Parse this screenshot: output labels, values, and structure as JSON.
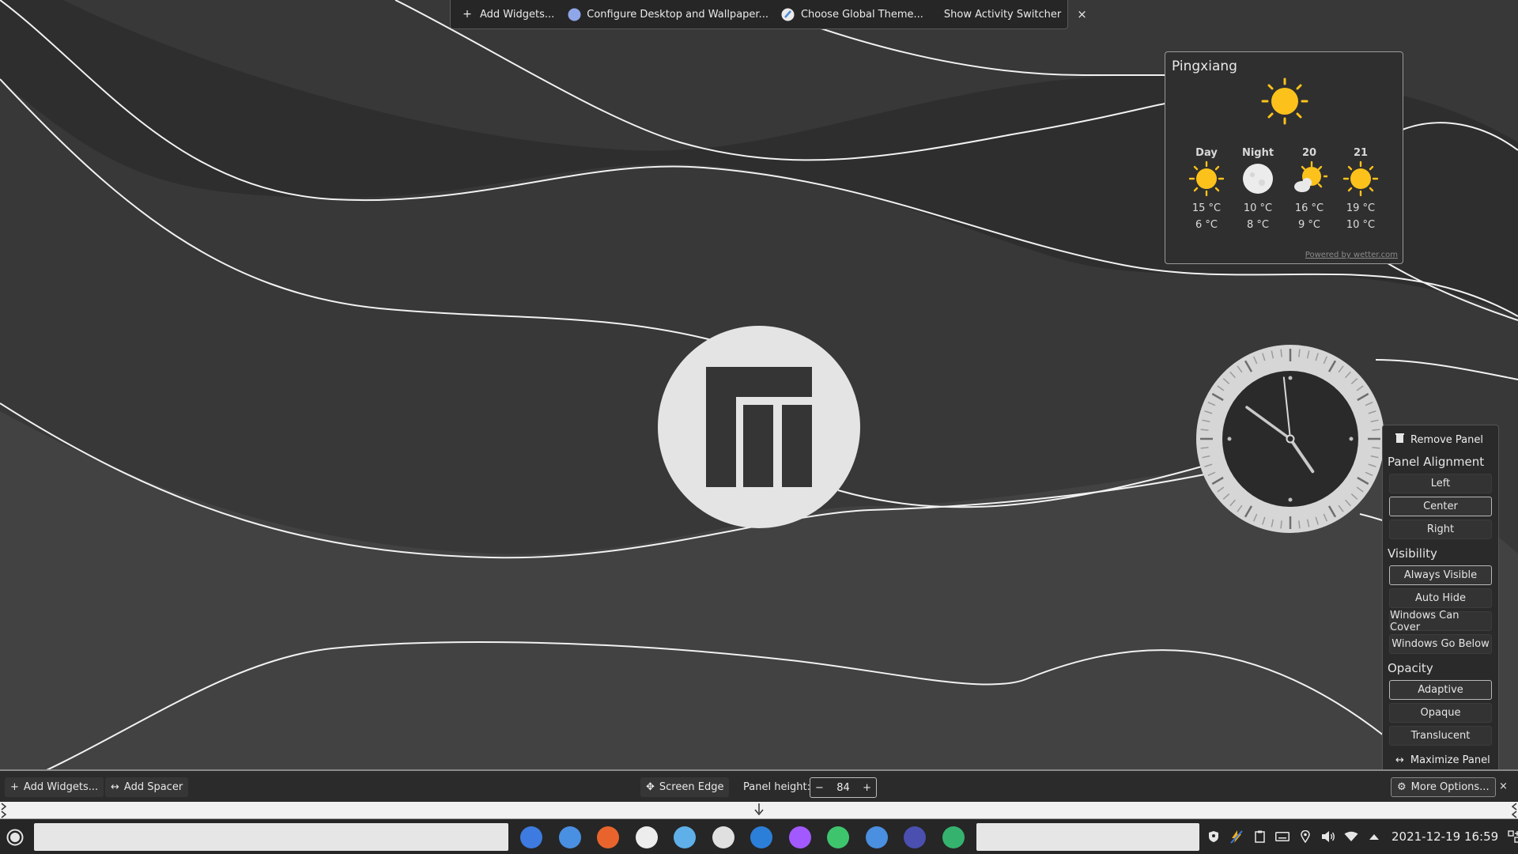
{
  "toolbar": {
    "add_widgets": "Add Widgets...",
    "configure_desktop": "Configure Desktop and Wallpaper...",
    "choose_theme": "Choose Global Theme...",
    "activity_switcher": "Show Activity Switcher",
    "close": "×"
  },
  "weather": {
    "city": "Pingxiang",
    "current_icon": "sun-icon",
    "forecast": [
      {
        "label": "Day",
        "icon": "sun-icon",
        "high": "15 °C",
        "low": "6 °C"
      },
      {
        "label": "Night",
        "icon": "moon-icon",
        "high": "10 °C",
        "low": "8 °C"
      },
      {
        "label": "20",
        "icon": "sun-cloud-icon",
        "high": "16 °C",
        "low": "9 °C"
      },
      {
        "label": "21",
        "icon": "sun-icon",
        "high": "19 °C",
        "low": "10 °C"
      }
    ],
    "powered": "Powered by wetter.com"
  },
  "clock": {
    "hour": 4,
    "minute": 51,
    "second": 59
  },
  "popup": {
    "remove_panel": "Remove Panel",
    "alignment_title": "Panel Alignment",
    "alignment": [
      "Left",
      "Center",
      "Right"
    ],
    "alignment_selected": "Center",
    "visibility_title": "Visibility",
    "visibility": [
      "Always Visible",
      "Auto Hide",
      "Windows Can Cover",
      "Windows Go Below"
    ],
    "visibility_selected": "Always Visible",
    "opacity_title": "Opacity",
    "opacity": [
      "Adaptive",
      "Opaque",
      "Translucent"
    ],
    "opacity_selected": "Adaptive",
    "maximize": "Maximize Panel"
  },
  "editbar": {
    "add_widgets": "Add Widgets...",
    "add_spacer": "Add Spacer",
    "screen_edge": "Screen Edge",
    "panel_height_label": "Panel height:",
    "panel_height_value": "84",
    "more_options": "More Options...",
    "close": "×"
  },
  "taskbar": {
    "apps": [
      {
        "name": "app-toggle-icon",
        "color": "#3d7be0"
      },
      {
        "name": "file-manager-icon",
        "color": "#4a90e2"
      },
      {
        "name": "firefox-icon",
        "color": "#e8642c"
      },
      {
        "name": "github-icon",
        "color": "#ededed"
      },
      {
        "name": "mail-icon",
        "color": "#5fb0e8"
      },
      {
        "name": "inkscape-icon",
        "color": "#e0e0e0"
      },
      {
        "name": "browser-icon",
        "color": "#2b7fd8"
      },
      {
        "name": "figma-icon",
        "color": "#a259ff"
      },
      {
        "name": "music-icon",
        "color": "#3ec46d"
      },
      {
        "name": "folder-icon",
        "color": "#4a8fe0"
      },
      {
        "name": "monitor-icon",
        "color": "#4a4fb0"
      },
      {
        "name": "openai-icon",
        "color": "#35b36e"
      }
    ],
    "clock": "2021-12-19 16:59"
  },
  "colors": {
    "sun": "#fcc21b",
    "accent": "#3daee9"
  }
}
